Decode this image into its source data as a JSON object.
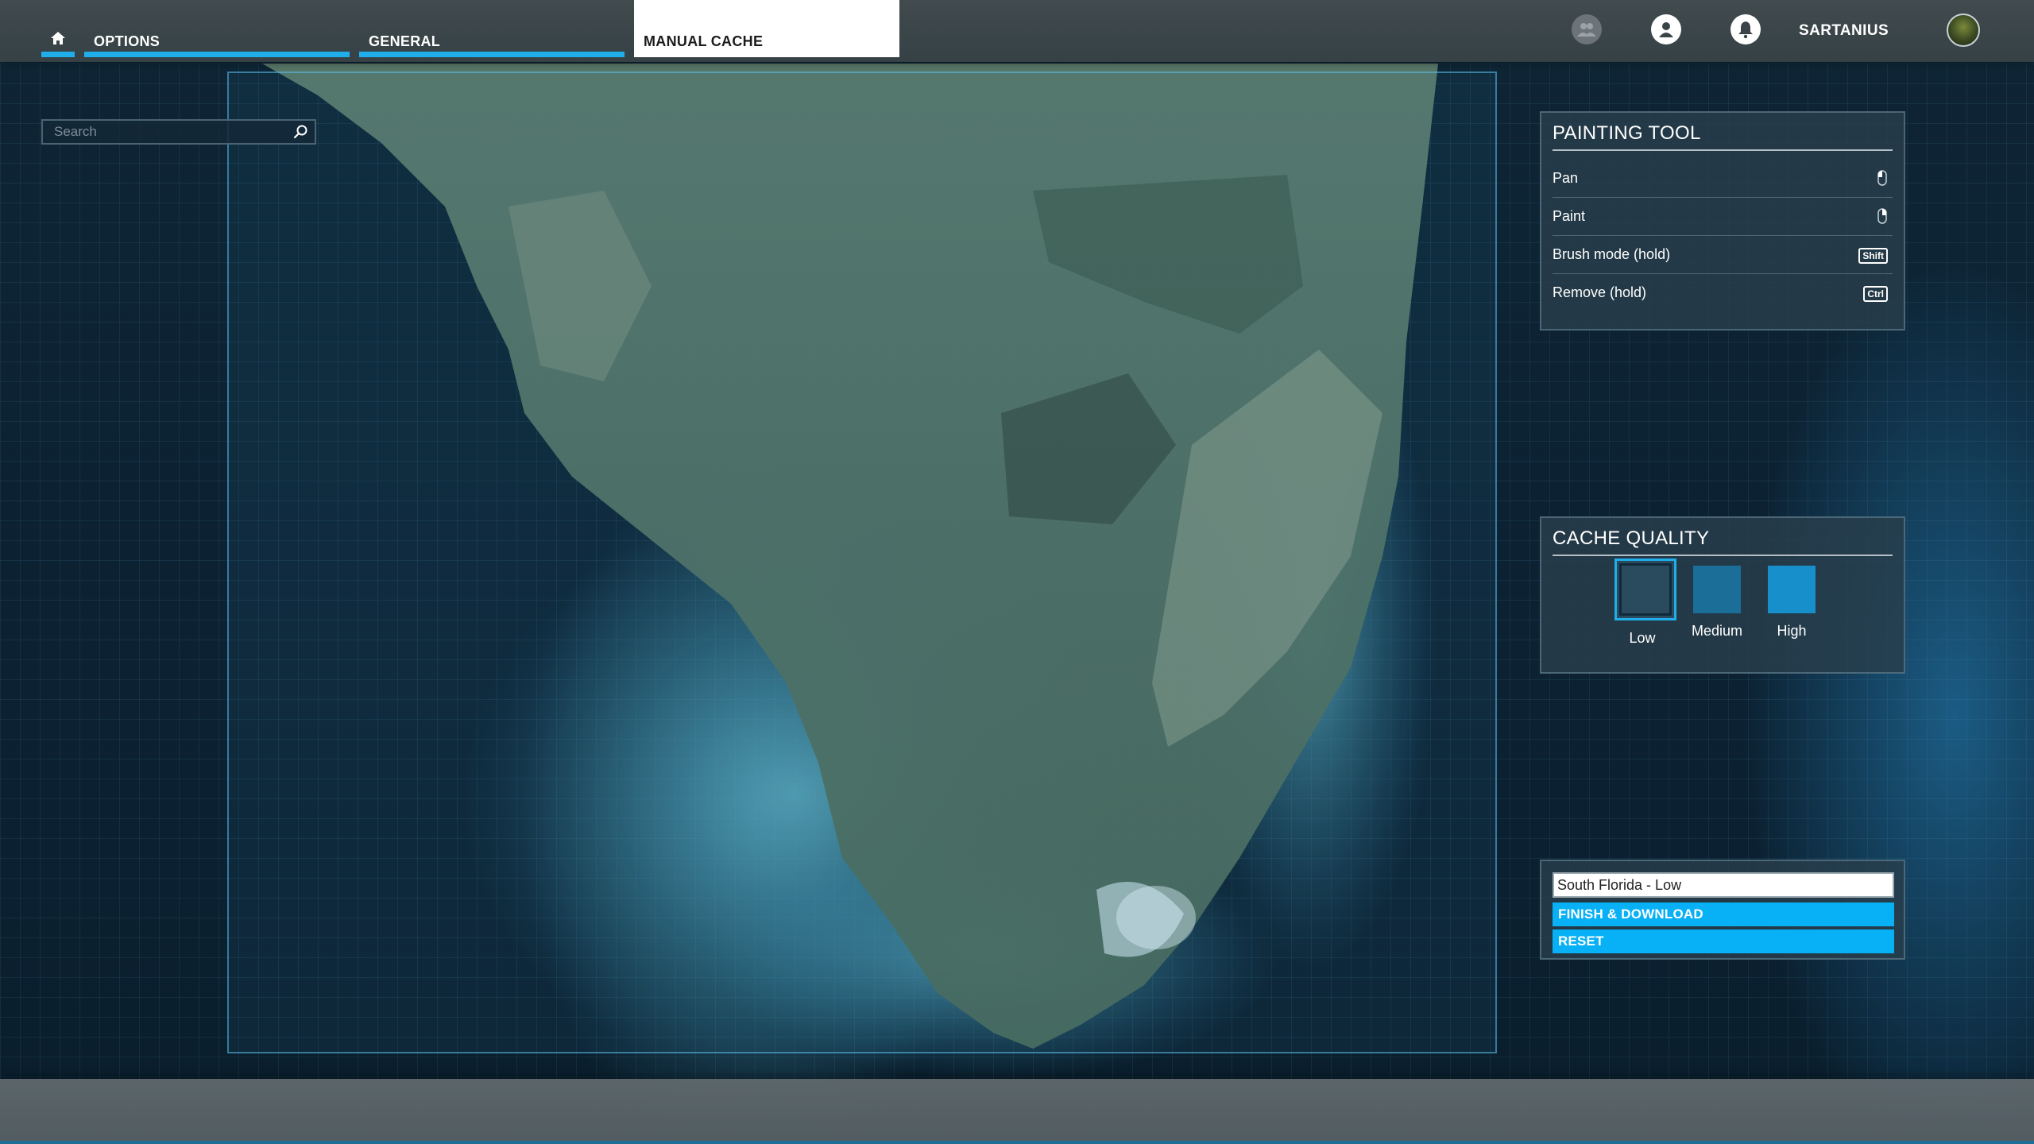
{
  "topbar": {
    "tabs": [
      {
        "id": "home",
        "icon": "home-icon"
      },
      {
        "id": "options",
        "label": "OPTIONS"
      },
      {
        "id": "general",
        "label": "GENERAL"
      },
      {
        "id": "manual_cache",
        "label": "MANUAL CACHE",
        "active": true
      }
    ],
    "icons": [
      "friends-icon",
      "profile-icon",
      "notifications-icon"
    ],
    "username": "SARTANIUS",
    "accent_color": "#1faee9"
  },
  "search": {
    "placeholder": "Search",
    "icon": "search-icon"
  },
  "painting_tool": {
    "title": "PAINTING TOOL",
    "rows": [
      {
        "label": "Pan",
        "key_icon": "left-mouse-icon"
      },
      {
        "label": "Paint",
        "key_icon": "right-mouse-icon"
      },
      {
        "label": "Brush mode (hold)",
        "key": "Shift"
      },
      {
        "label": "Remove (hold)",
        "key": "Ctrl"
      }
    ]
  },
  "cache_quality": {
    "title": "CACHE QUALITY",
    "options": [
      {
        "label": "Low",
        "selected": true,
        "color": "#2a4a5e"
      },
      {
        "label": "Medium",
        "selected": false,
        "color": "#1b6e98"
      },
      {
        "label": "High",
        "selected": false,
        "color": "#168fca"
      }
    ]
  },
  "download": {
    "cache_name": "South Florida - Low",
    "finish_label": "FINISH & DOWNLOAD",
    "reset_label": "RESET",
    "button_color": "#08b0f5"
  }
}
